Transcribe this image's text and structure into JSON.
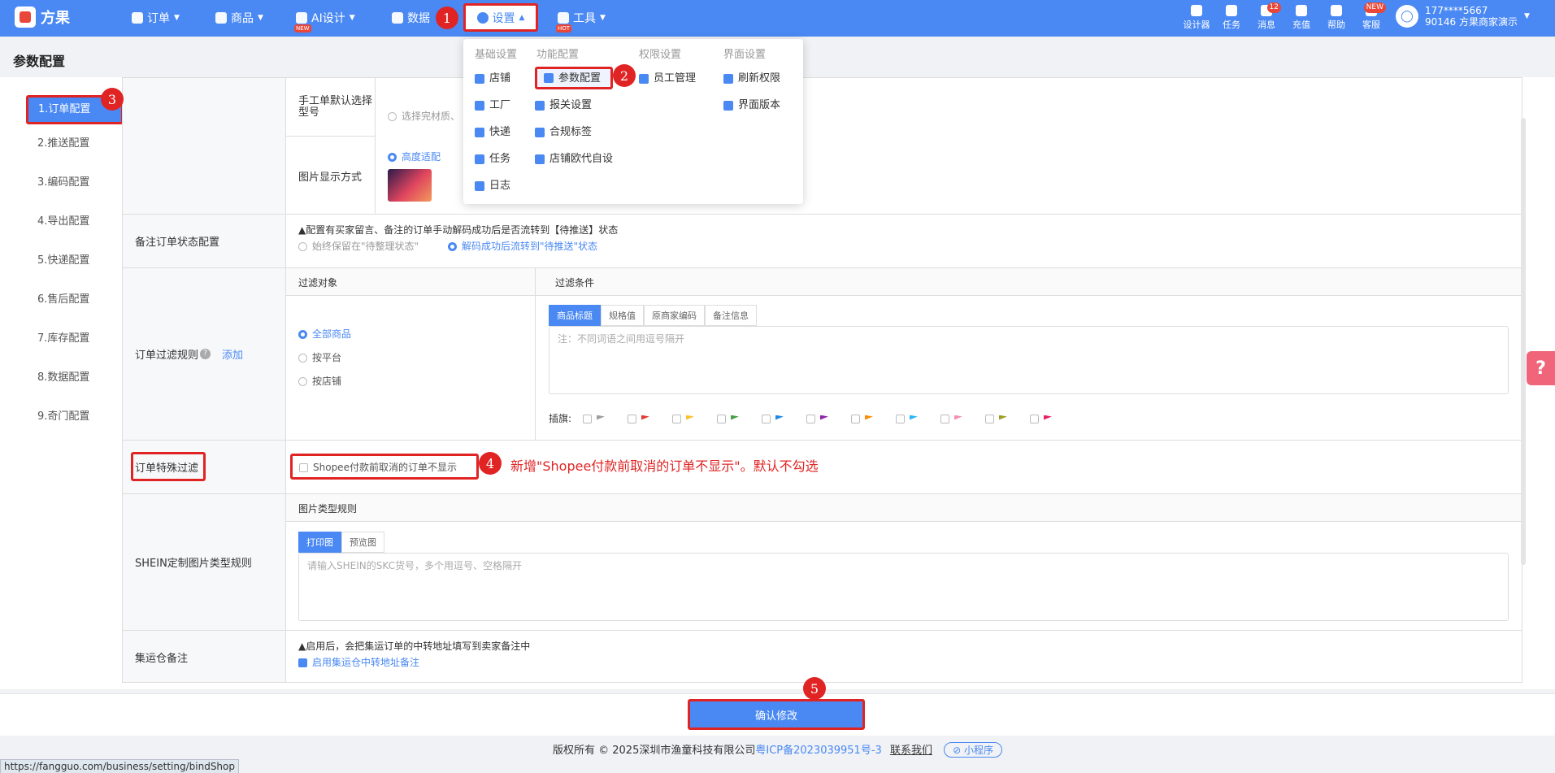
{
  "brand": "方果",
  "nav": {
    "orders": "订单",
    "products": "商品",
    "ai": "AI设计",
    "ai_tag": "NEW",
    "data": "数据",
    "settings": "设置",
    "tools": "工具",
    "tools_tag": "HOT"
  },
  "toolbar": {
    "designer": "设计器",
    "tasks": "任务",
    "messages": "消息",
    "messages_badge": "12",
    "recharge": "充值",
    "help": "帮助",
    "service": "客服",
    "service_tag": "NEW"
  },
  "user": {
    "phone": "177****5667",
    "shop": "90146 方果商家演示"
  },
  "page_title": "参数配置",
  "left_nav": [
    "1.订单配置",
    "2.推送配置",
    "3.编码配置",
    "4.导出配置",
    "5.快递配置",
    "6.售后配置",
    "7.库存配置",
    "8.数据配置",
    "9.奇门配置"
  ],
  "dropdown": {
    "cols": [
      "基础设置",
      "功能配置",
      "权限设置",
      "界面设置"
    ],
    "basic": [
      "店铺",
      "工厂",
      "快递",
      "任务",
      "日志"
    ],
    "function": [
      "参数配置",
      "报关设置",
      "合规标签",
      "店铺欧代自设"
    ],
    "permission": [
      "员工管理"
    ],
    "ui": [
      "刷新权限",
      "界面版本"
    ]
  },
  "rows": {
    "manual_order_label": "手工单默认选择型号",
    "manual_order_option": "选择完材质、",
    "image_display_label": "图片显示方式",
    "image_display_option": "高度适配",
    "remark_status_label": "备注订单状态配置",
    "remark_status_note": "▲配置有买家留言、备注的订单手动解码成功后是否流转到【待推送】状态",
    "remark_status_opt1": "始终保留在\"待整理状态\"",
    "remark_status_opt2": "解码成功后流转到\"待推送\"状态",
    "filter_label": "订单过滤规则",
    "filter_add": "添加",
    "filter_object": "过滤对象",
    "filter_condition": "过滤条件",
    "filter_obj_opts": [
      "全部商品",
      "按平台",
      "按店铺"
    ],
    "filter_tabs": [
      "商品标题",
      "规格值",
      "原商家编码",
      "备注信息"
    ],
    "filter_placeholder": "注：不同词语之间用逗号隔开",
    "flag_label": "插旗:",
    "flag_colors": [
      "#9e9e9e",
      "#e53935",
      "#fbc02d",
      "#43a047",
      "#1e88e5",
      "#8e24aa",
      "#fb8c00",
      "#29b6f6",
      "#f48fb1",
      "#9e9d24",
      "#e91e63"
    ],
    "special_label": "订单特殊过滤",
    "special_option": "Shopee付款前取消的订单不显示",
    "shein_label": "SHEIN定制图片类型规则",
    "shein_sub": "图片类型规则",
    "shein_tabs": [
      "打印图",
      "预览图"
    ],
    "shein_placeholder": "请输入SHEIN的SKC货号，多个用逗号、空格隔开",
    "consol_label": "集运仓备注",
    "consol_note": "▲启用后，会把集运订单的中转地址填写到卖家备注中",
    "consol_option": "启用集运仓中转地址备注"
  },
  "annotation": "新增\"Shopee付款前取消的订单不显示\"。默认不勾选",
  "markers": [
    "1",
    "2",
    "3",
    "4",
    "5"
  ],
  "confirm": "确认修改",
  "footer": {
    "copyright": "版权所有 © 2025深圳市渔童科技有限公司",
    "icp": "粤ICP备2023039951号-3",
    "contact": "联系我们",
    "mini": "小程序"
  },
  "status_url": "https://fangguo.com/business/setting/bindShop"
}
